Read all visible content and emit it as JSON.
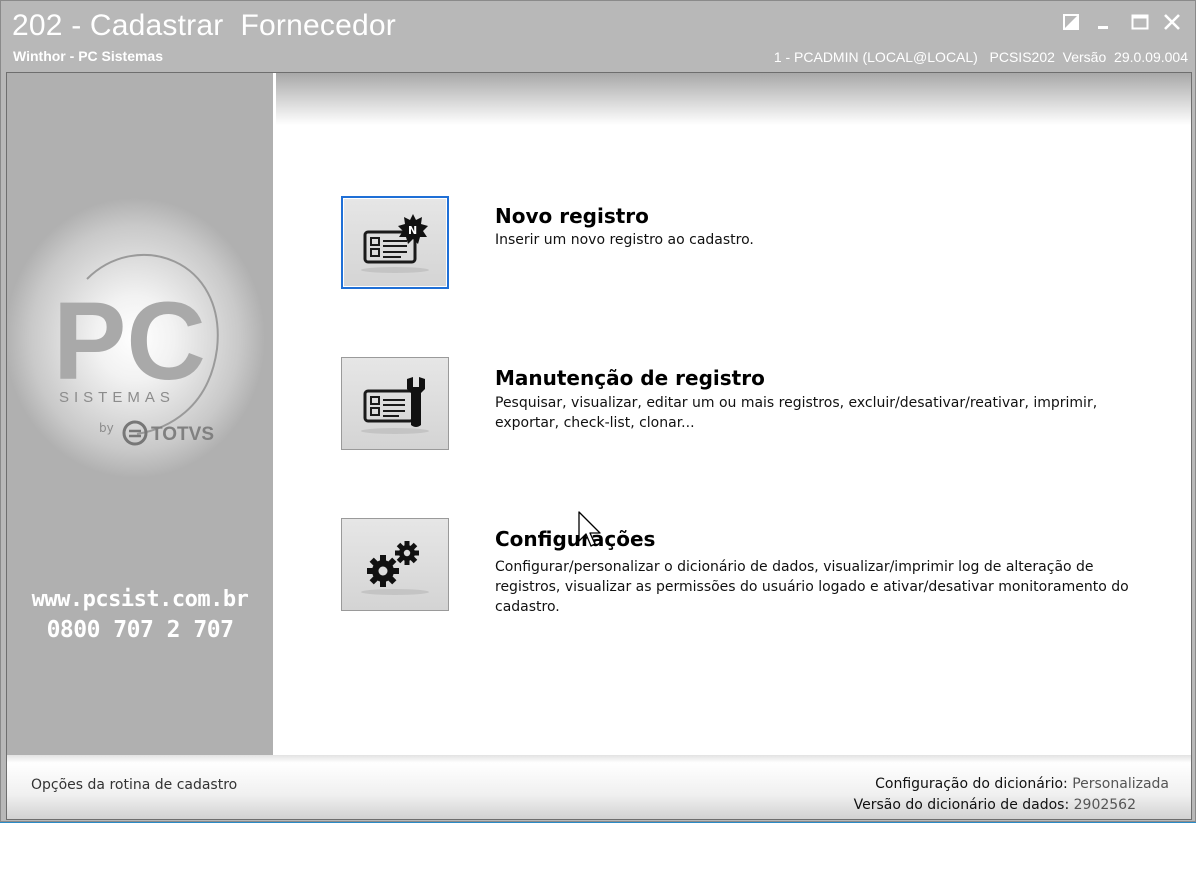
{
  "window": {
    "title": "202 - Cadastrar  Fornecedor",
    "subtitle": "Winthor - PC Sistemas",
    "session": "1 - PCADMIN (LOCAL@LOCAL)   PCSIS202  Versão  29.0.09.004",
    "controls": [
      "restore-icon",
      "minimize-icon",
      "maximize-icon",
      "close-icon"
    ]
  },
  "sidebar": {
    "logo_text": "PC",
    "logo_sub": "SISTEMAS",
    "logo_by": "by",
    "logo_brand": "TOTVS",
    "website": "www.pcsist.com.br",
    "phone": "0800 707 2 707"
  },
  "options": [
    {
      "title": "Novo registro",
      "description": "Inserir um novo registro ao cadastro.",
      "icon": "new-record-icon"
    },
    {
      "title": "Manutenção de registro",
      "description": "Pesquisar, visualizar, editar um ou mais registros, excluir/desativar/reativar, imprimir, exportar, check-list,  clonar...",
      "icon": "maintenance-icon"
    },
    {
      "title": "Configurações",
      "description": "Configurar/personalizar o dicionário de dados, visualizar/imprimir log de alteração de registros, visualizar as permissões do usuário logado e ativar/desativar monitoramento do cadastro.",
      "icon": "gears-icon"
    }
  ],
  "footer": {
    "left_text": "Opções da rotina de cadastro",
    "dict_config_label": "Configuração do dicionário:",
    "dict_config_value": "Personalizada",
    "dict_version_label": "Versão do dicionário de dados:",
    "dict_version_value": "2902562"
  },
  "colors": {
    "title_bar": "#b8b8b8",
    "focus_border": "#1f6fd6"
  }
}
